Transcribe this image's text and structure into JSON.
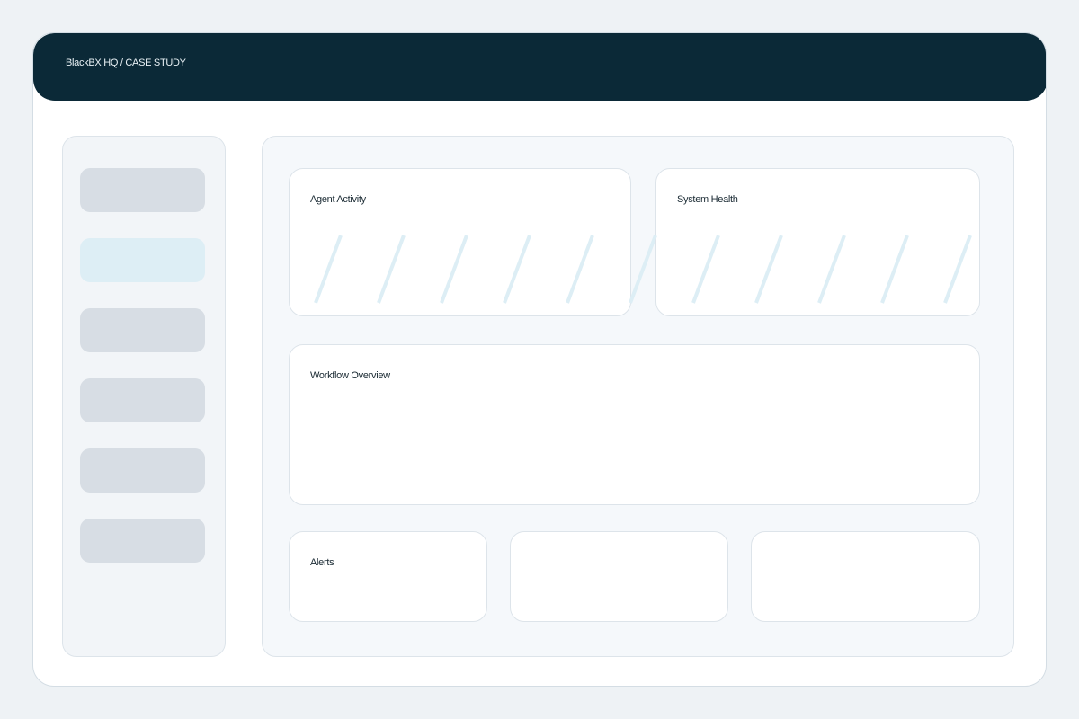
{
  "header": {
    "title": "BlackBX HQ / CASE STUDY"
  },
  "sidebar": {
    "items": [
      {
        "id": "nav-1",
        "active": false
      },
      {
        "id": "nav-2",
        "active": true
      },
      {
        "id": "nav-3",
        "active": false
      },
      {
        "id": "nav-4",
        "active": false
      },
      {
        "id": "nav-5",
        "active": false
      },
      {
        "id": "nav-6",
        "active": false
      }
    ]
  },
  "cards": {
    "agent_activity": {
      "title": "Agent Activity"
    },
    "system_health": {
      "title": "System Health"
    },
    "workflow_overview": {
      "title": "Workflow Overview"
    },
    "alerts": {
      "title": "Alerts"
    }
  },
  "colors": {
    "header_bg": "#0b2937",
    "accent_stripe": "#ddeef5",
    "nav_active": "#ddeef5",
    "nav_inactive": "#d7dde4"
  }
}
